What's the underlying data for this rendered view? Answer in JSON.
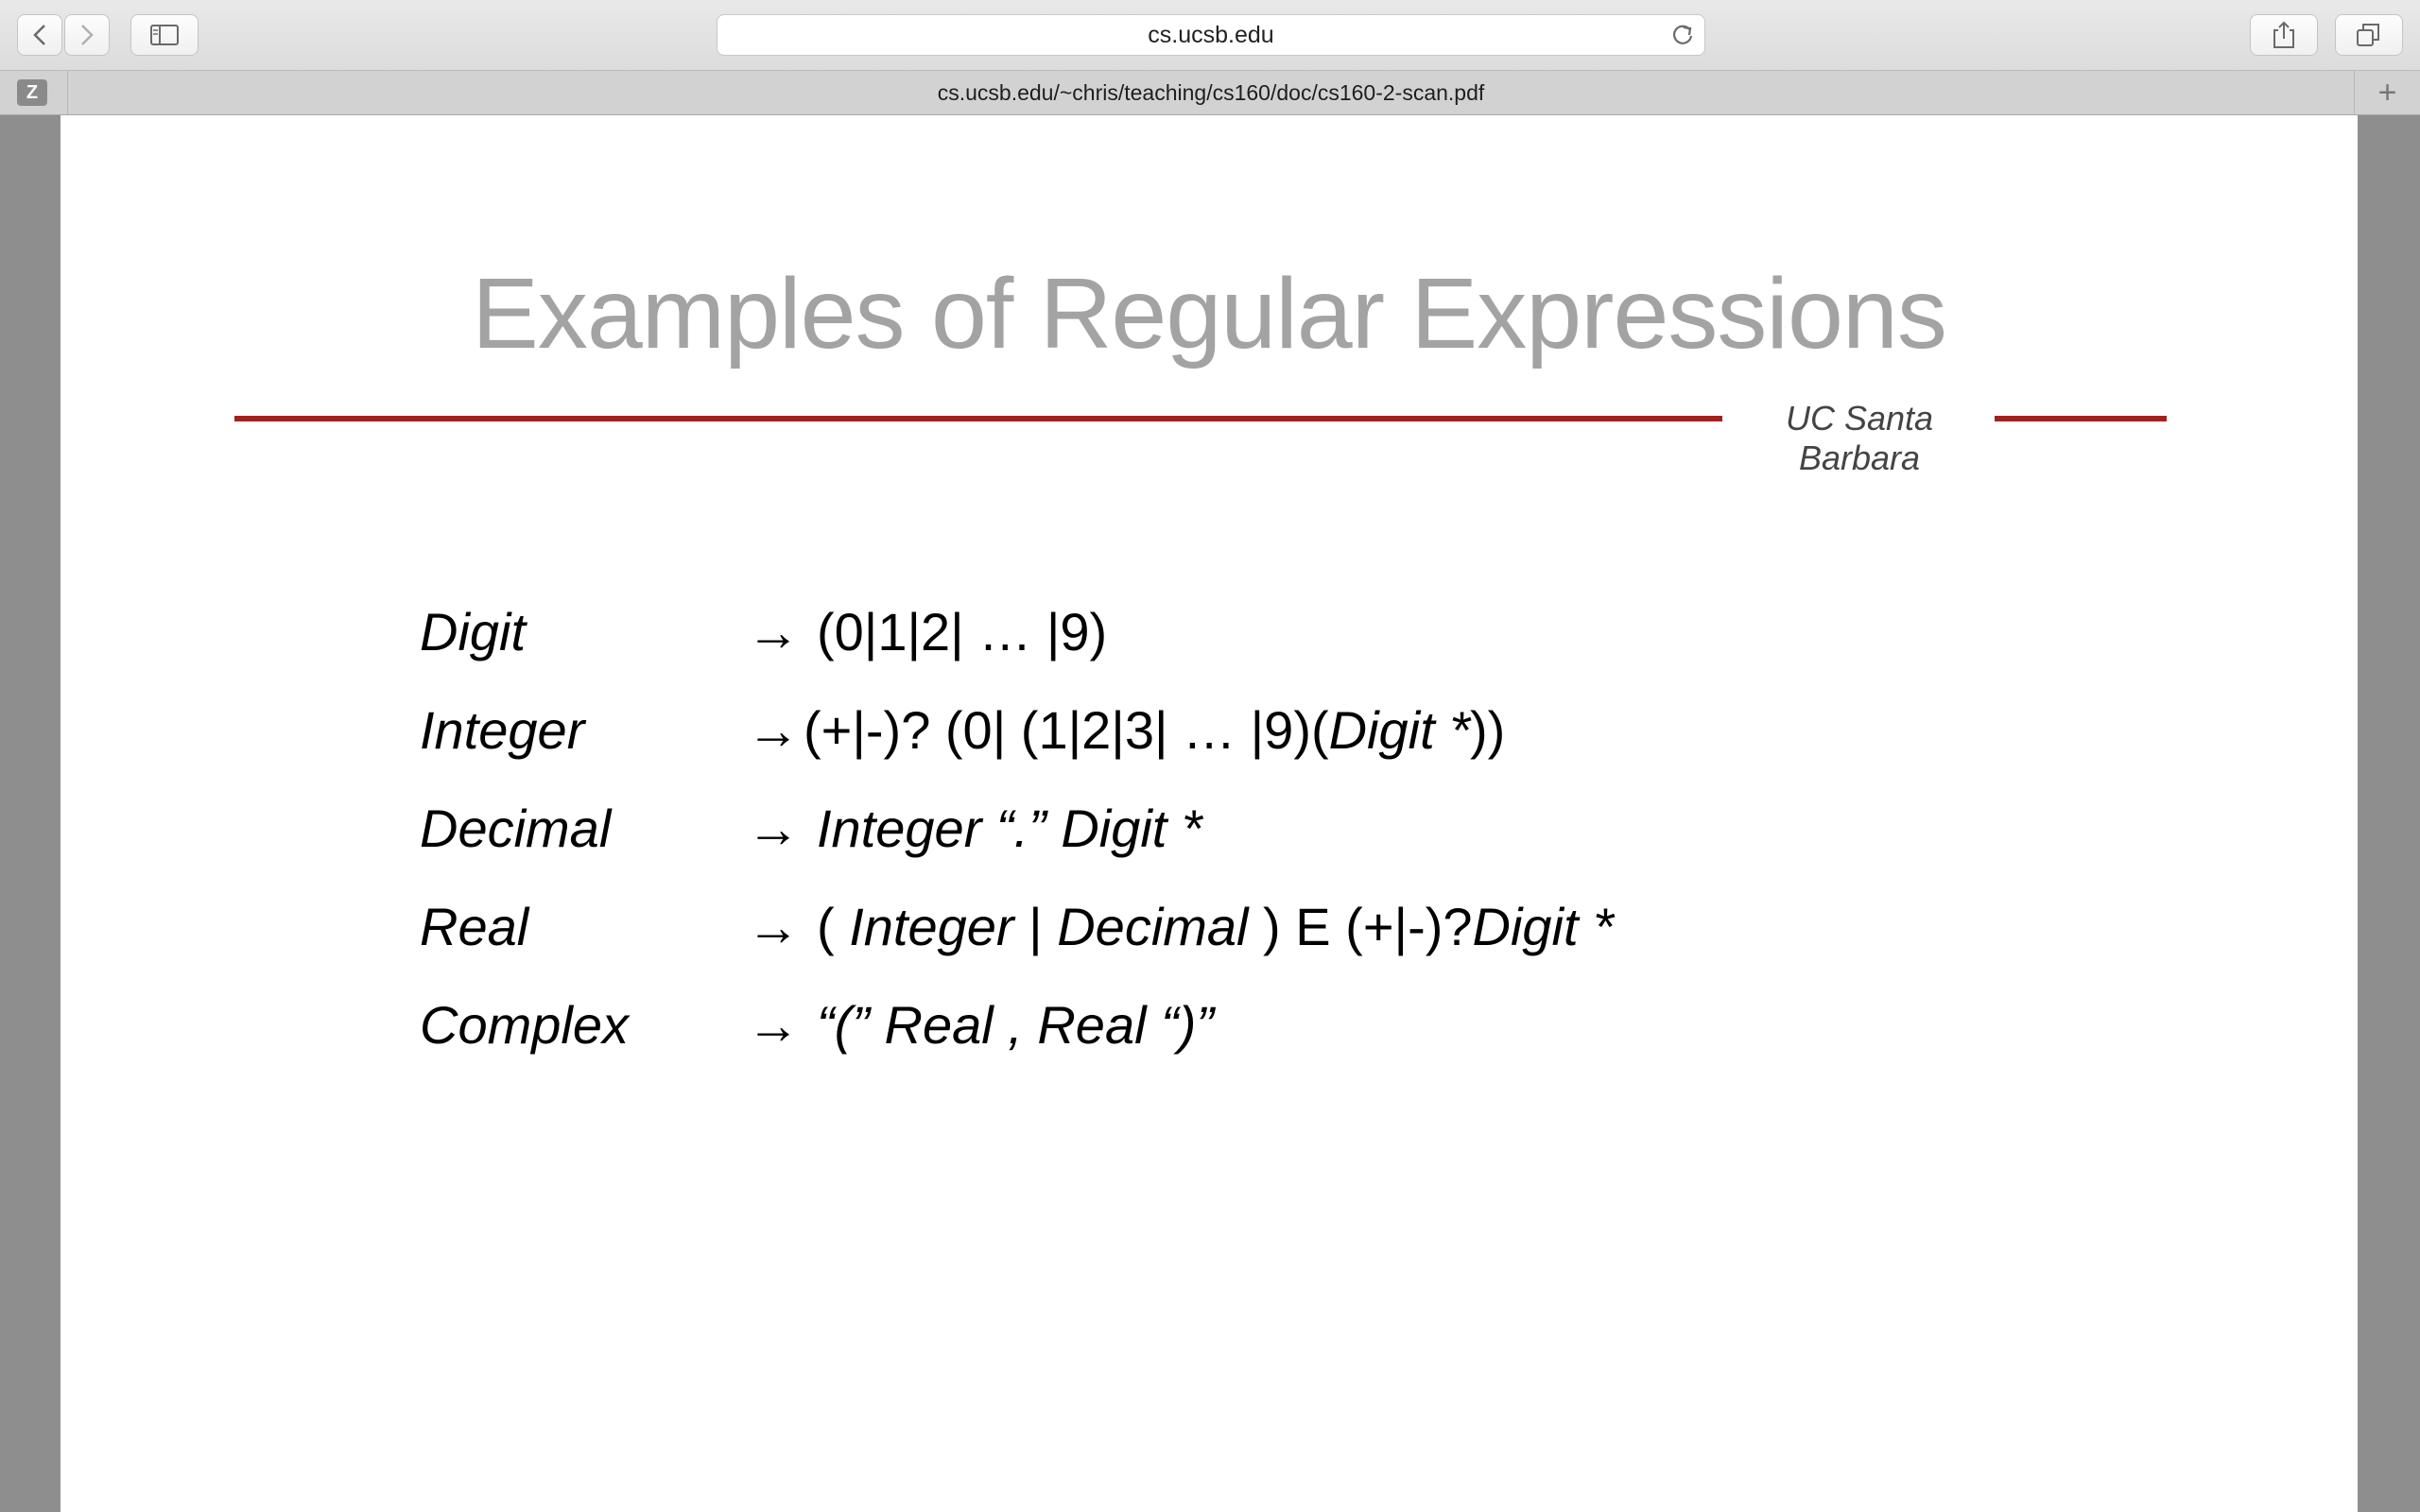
{
  "browser": {
    "address": "cs.ucsb.edu",
    "tab_title": "cs.ucsb.edu/~chris/teaching/cs160/doc/cs160-2-scan.pdf",
    "tab_favicon_letter": "Z",
    "new_tab_glyph": "+",
    "icons": [
      "back-icon",
      "forward-icon",
      "sidebar-icon",
      "reload-icon",
      "share-icon",
      "tabs-overview-icon"
    ]
  },
  "slide": {
    "title": "Examples of Regular Expressions",
    "institution": "UC Santa Barbara",
    "accent_color": "#a0211e",
    "arrow": "→",
    "rows": [
      {
        "name": "Digit",
        "rhs": [
          "(0|1|2| … |9)"
        ]
      },
      {
        "name": "Integer",
        "rhs": [
          "(+|-)? (0| (1|2|3| … |9)(",
          "Digit *",
          "))"
        ]
      },
      {
        "name": "Decimal",
        "rhs": [
          "Integer “.” Digit *"
        ]
      },
      {
        "name": "Real",
        "rhs": [
          "( ",
          "Integer",
          " | ",
          "Decimal",
          " ) E (+|-)?",
          "Digit *"
        ]
      },
      {
        "name": "Complex",
        "rhs": [
          "“(” Real ,  Real “)”"
        ]
      }
    ]
  }
}
